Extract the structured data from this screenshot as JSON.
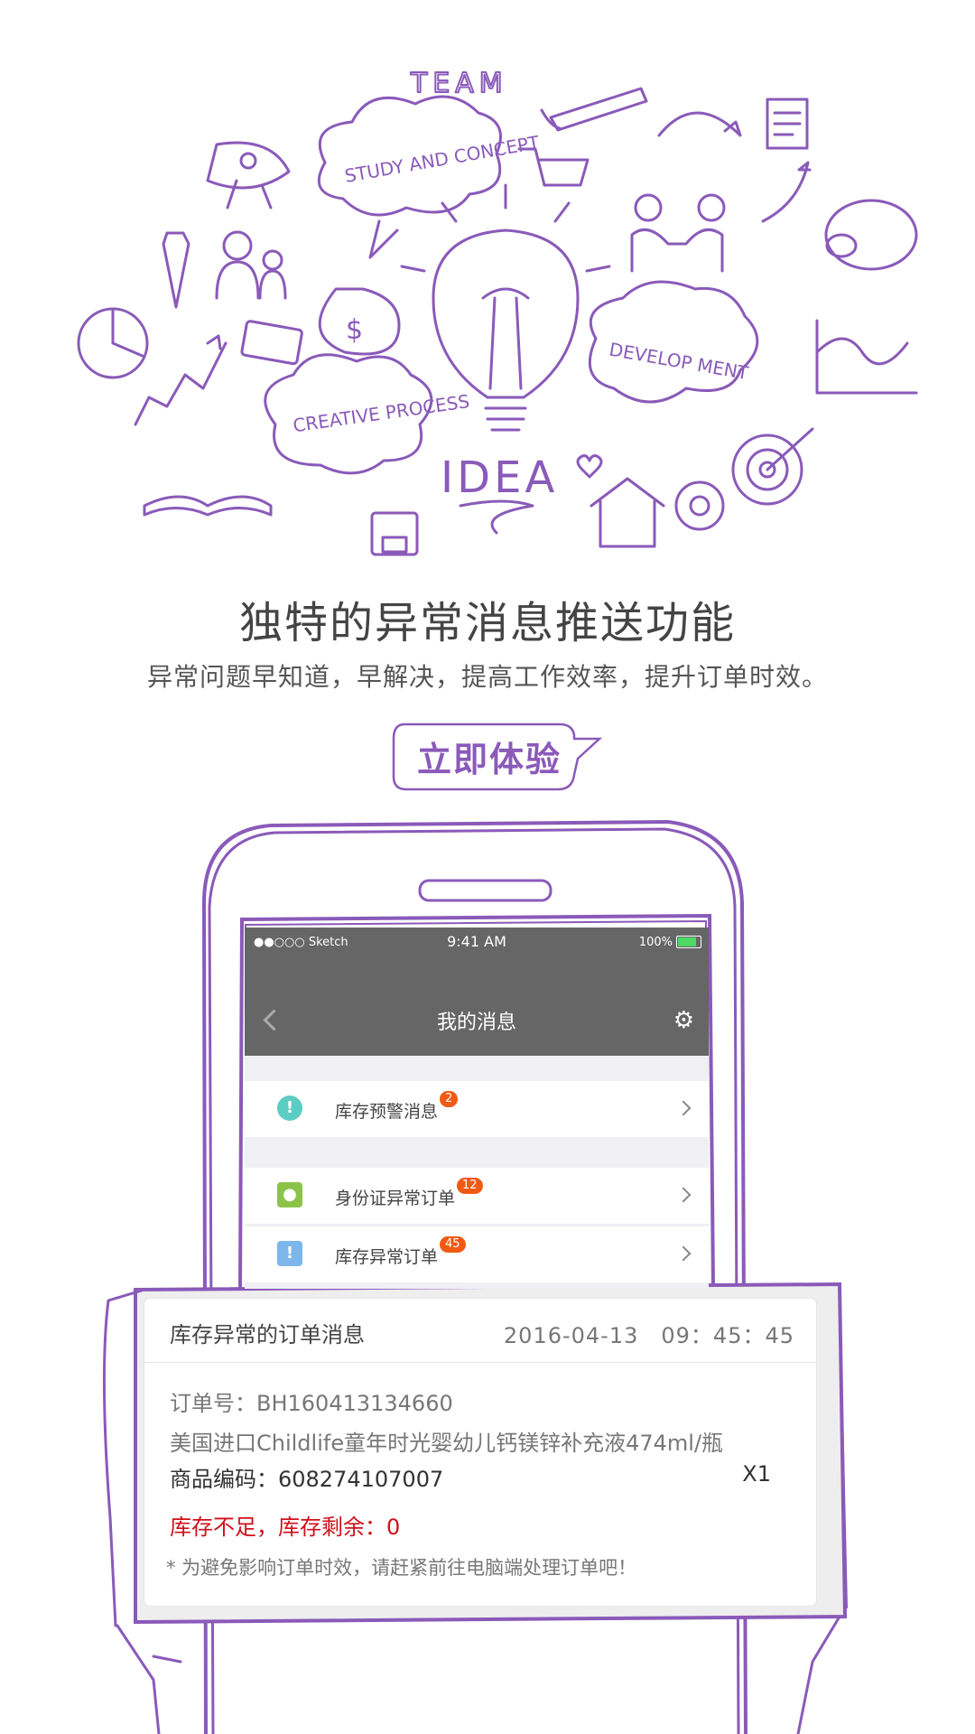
{
  "hero": {
    "doodles": [
      "TEAM",
      "STUDY AND CONCEPT",
      "DEVELOP MENT",
      "CREATIVE PROCESS",
      "IDEA",
      "$"
    ],
    "accent_color": "#8a5ab9"
  },
  "headline": {
    "title": "独特的异常消息推送功能",
    "subtitle": "异常问题早知道，早解决，提高工作效率，提升订单时效。"
  },
  "cta": {
    "label": "立即体验"
  },
  "phone": {
    "status": {
      "carrier": "●●○○○ Sketch",
      "time": "9:41 AM",
      "battery": "100%"
    },
    "nav": {
      "title": "我的消息",
      "back_icon": "chevron-left-icon",
      "settings_icon": "gear-icon"
    },
    "items": [
      {
        "label": "库存预警消息",
        "badge": "2",
        "icon": "alert-badge-icon",
        "color": "#5ccdc3"
      },
      {
        "label": "身份证异常订单",
        "badge": "12",
        "icon": "id-card-icon",
        "color": "#8bc34a"
      },
      {
        "label": "库存异常订单",
        "badge": "45",
        "icon": "clipboard-alert-icon",
        "color": "#7cb6ea"
      }
    ]
  },
  "notification": {
    "title": "库存异常的订单消息",
    "time": "2016-04-13　09：45：45",
    "order_no": "订单号：BH160413134660",
    "product": "美国进口Childlife童年时光婴幼儿钙镁锌补充液474ml/瓶",
    "sku": "商品编码：608274107007",
    "qty": "X1",
    "stock_warning": "库存不足，库存剩余：0",
    "note": "* 为避免影响订单时效，请赶紧前往电脑端处理订单吧！",
    "warning_color": "#d0101a"
  }
}
